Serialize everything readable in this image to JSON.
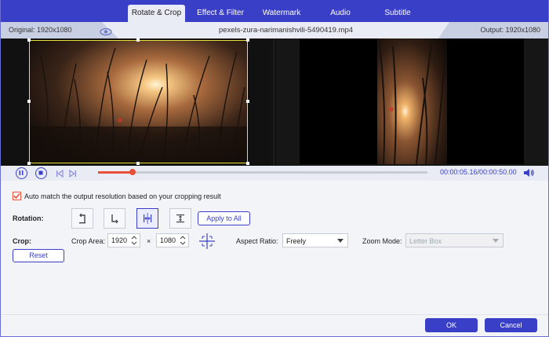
{
  "tabs": [
    {
      "label": "Rotate & Crop",
      "active": true
    },
    {
      "label": "Effect & Filter",
      "active": false
    },
    {
      "label": "Watermark",
      "active": false
    },
    {
      "label": "Audio",
      "active": false
    },
    {
      "label": "Subtitle",
      "active": false
    }
  ],
  "info": {
    "original": "Original: 1920x1080",
    "filename": "pexels-zura-narimanishvili-5490419.mp4",
    "output": "Output: 1920x1080"
  },
  "player": {
    "timecode": "00:00:05.16/00:00:50.00",
    "progress": 0.104
  },
  "settings": {
    "auto_match": "Auto match the output resolution based on your cropping result",
    "auto_match_checked": true,
    "rotation_label": "Rotation:",
    "apply_to_all": "Apply to All",
    "crop_label": "Crop:",
    "crop_area_label": "Crop Area:",
    "crop_width": "1920",
    "crop_x": "×",
    "crop_height": "1080",
    "aspect_ratio_label": "Aspect Ratio:",
    "aspect_ratio_value": "Freely",
    "zoom_mode_label": "Zoom Mode:",
    "zoom_mode_value": "Letter Box",
    "reset": "Reset"
  },
  "footer": {
    "ok": "OK",
    "cancel": "Cancel"
  },
  "colors": {
    "accent": "#3a3fc7",
    "progress": "#e8503a",
    "crop_border": "#e8e23a"
  }
}
